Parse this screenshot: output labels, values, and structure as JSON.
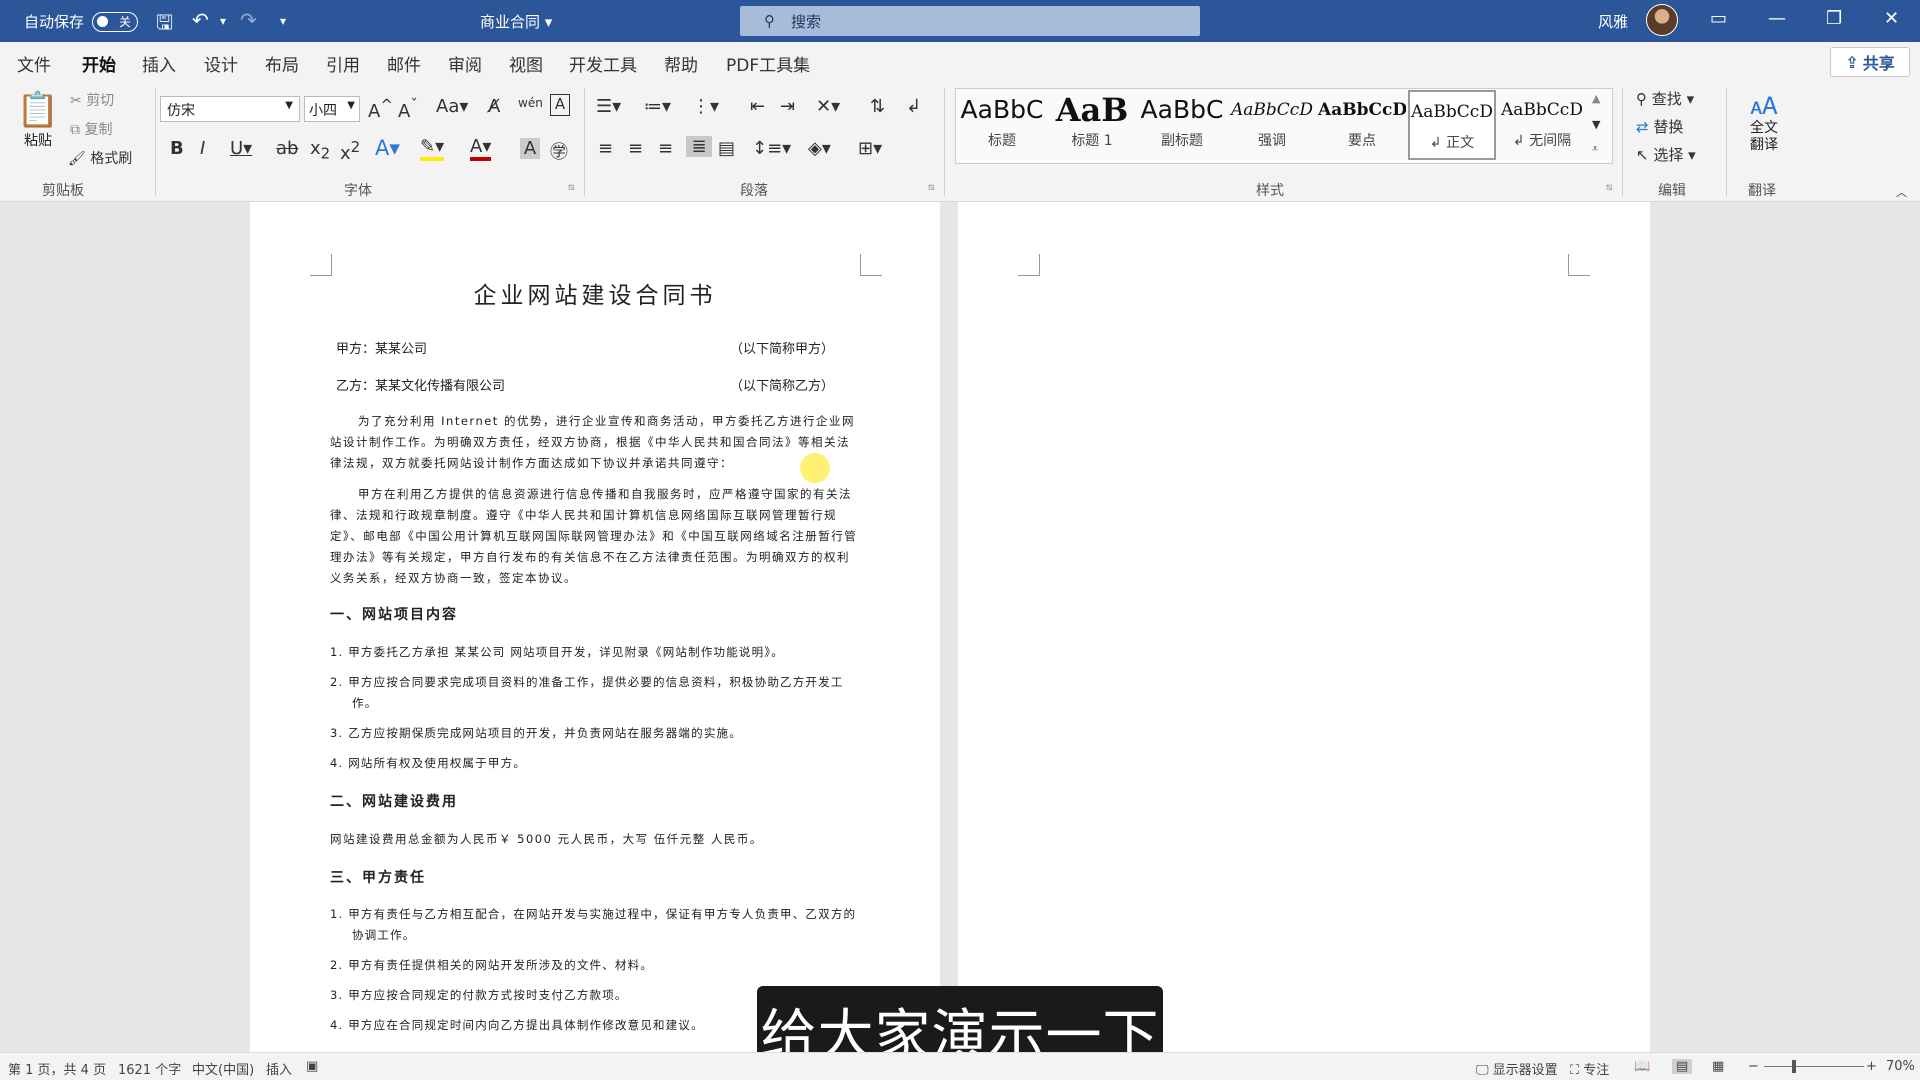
{
  "titlebar": {
    "autosave_label": "自动保存",
    "autosave_state": "关",
    "doc_title": "商业合同",
    "search_placeholder": "搜索",
    "user_name": "风雅"
  },
  "menu": {
    "tabs": [
      "文件",
      "开始",
      "插入",
      "设计",
      "布局",
      "引用",
      "邮件",
      "审阅",
      "视图",
      "开发工具",
      "帮助",
      "PDF工具集"
    ],
    "active_tab": "开始",
    "share_label": "共享"
  },
  "ribbon": {
    "clipboard": {
      "paste": "粘贴",
      "cut": "剪切",
      "copy": "复制",
      "format_painter": "格式刷",
      "label": "剪贴板"
    },
    "font": {
      "name": "仿宋",
      "size": "小四",
      "label": "字体"
    },
    "paragraph": {
      "label": "段落"
    },
    "styles": {
      "label": "样式",
      "items": [
        {
          "preview": "AaBbC",
          "name": "标题"
        },
        {
          "preview": "AaB",
          "name": "标题 1"
        },
        {
          "preview": "AaBbC",
          "name": "副标题"
        },
        {
          "preview": "AaBbCcD",
          "name": "强调"
        },
        {
          "preview": "AaBbCcD",
          "name": "要点"
        },
        {
          "preview": "AaBbCcD",
          "name": "正文"
        },
        {
          "preview": "AaBbCcD",
          "name": "无间隔"
        }
      ]
    },
    "editing": {
      "find": "查找",
      "replace": "替换",
      "select": "选择",
      "label": "编辑"
    },
    "translate": {
      "button": "全文\n翻译",
      "label": "翻译"
    }
  },
  "document": {
    "title": "企业网站建设合同书",
    "party_a": "甲方：某某公司",
    "party_a_note": "（以下简称甲方）",
    "party_b": "乙方：某某文化传播有限公司",
    "party_b_note": "（以下简称乙方）",
    "para1": "为了充分利用 Internet 的优势，进行企业宣传和商务活动，甲方委托乙方进行企业网站设计制作工作。为明确双方责任，经双方协商，根据《中华人民共和国合同法》等相关法律法规，双方就委托网站设计制作方面达成如下协议并承诺共同遵守：",
    "para2": "甲方在利用乙方提供的信息资源进行信息传播和自我服务时，应严格遵守国家的有关法律、法规和行政规章制度。遵守《中华人民共和国计算机信息网络国际互联网管理暂行规定》、邮电部《中国公用计算机互联网国际联网管理办法》和《中国互联网络域名注册暂行管理办法》等有关规定，甲方自行发布的有关信息不在乙方法律责任范围。为明确双方的权利义务关系，经双方协商一致，签定本协议。",
    "section1": "一、网站项目内容",
    "s1_items": [
      "1.  甲方委托乙方承担  某某公司  网站项目开发，详见附录《网站制作功能说明》。",
      "2.  甲方应按合同要求完成项目资料的准备工作，提供必要的信息资料，积极协助乙方开发工作。",
      "3.  乙方应按期保质完成网站项目的开发，并负责网站在服务器端的实施。",
      "4.  网站所有权及使用权属于甲方。"
    ],
    "section2": "二、网站建设费用",
    "fee": "网站建设费用总金额为人民币￥ 5000 元人民币，大写  伍仟元整  人民币。",
    "section3": "三、甲方责任",
    "s3_items": [
      "1.  甲方有责任与乙方相互配合，在网站开发与实施过程中，保证有甲方专人负责甲、乙双方的协调工作。",
      "2.  甲方有责任提供相关的网站开发所涉及的文件、材料。",
      "3.  甲方应按合同规定的付款方式按时支付乙方款项。",
      "4.  甲方应在合同规定时间内向乙方提出具体制作修改意见和建议。"
    ]
  },
  "subtitle": "给大家演示一下",
  "statusbar": {
    "page": "第 1 页，共 4 页",
    "words": "1621 个字",
    "lang": "中文(中国)",
    "mode": "插入",
    "display": "显示器设置",
    "focus": "专注",
    "zoom": "70%"
  }
}
